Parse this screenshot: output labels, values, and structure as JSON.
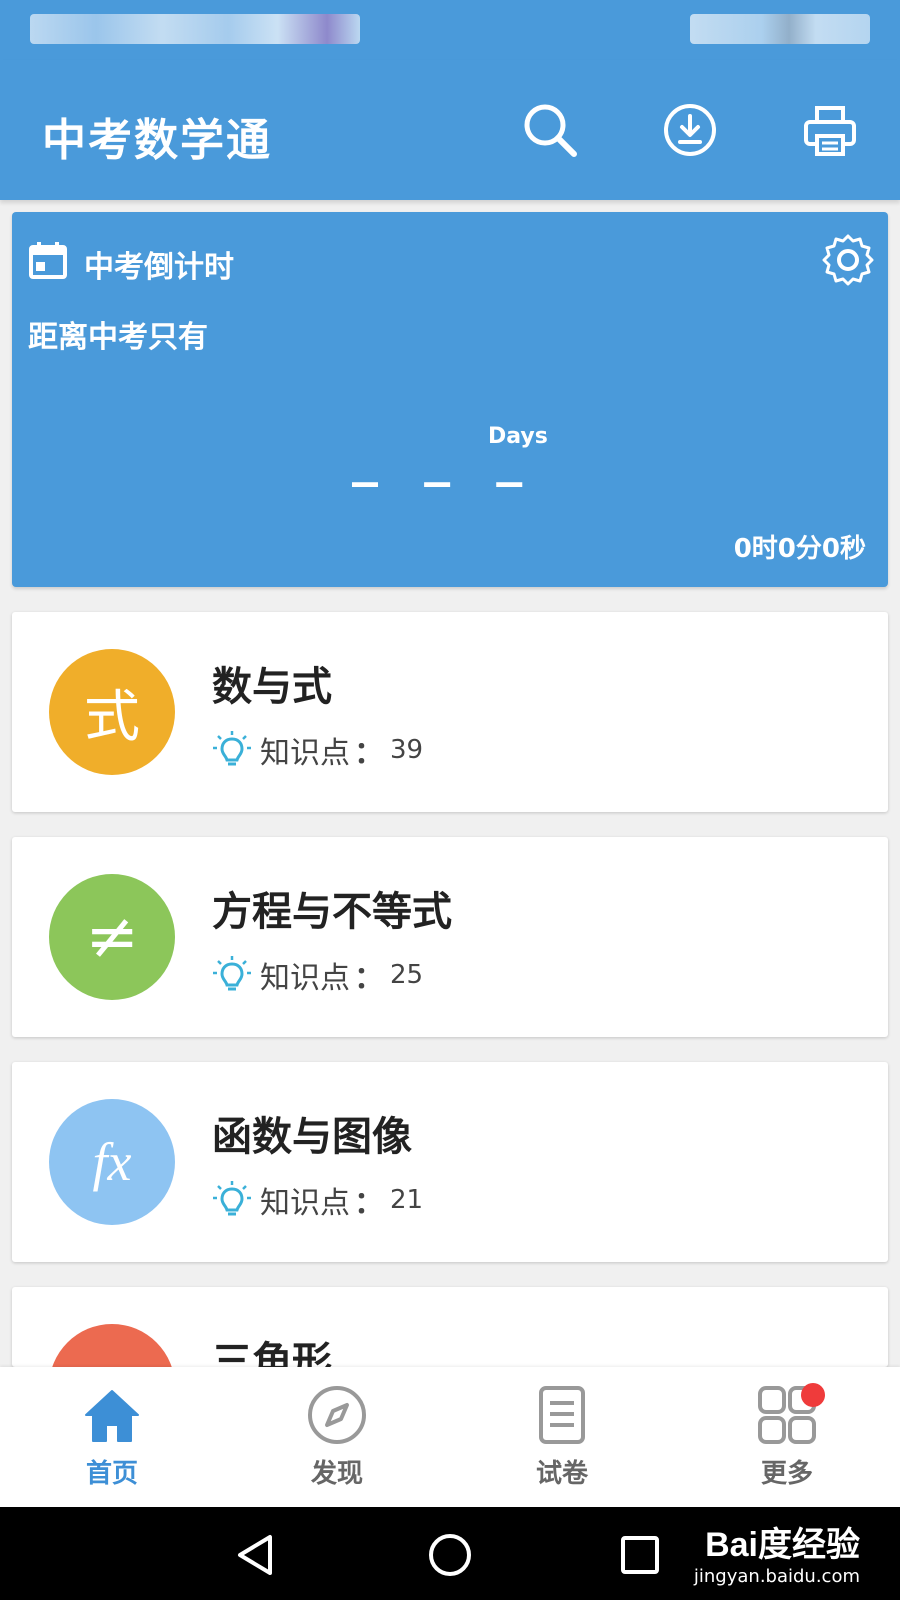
{
  "app": {
    "title": "中考数学通"
  },
  "header_actions": [
    {
      "id": "search",
      "icon": "search-icon"
    },
    {
      "id": "download",
      "icon": "download-icon"
    },
    {
      "id": "print",
      "icon": "printer-icon"
    }
  ],
  "countdown": {
    "title": "中考倒计时",
    "subtitle": "距离中考只有",
    "days": "_ _ _",
    "days_unit": "Days",
    "time": "0时0分0秒",
    "icons": [
      "calendar-icon",
      "gear-icon"
    ]
  },
  "topics": [
    {
      "title": "数与式",
      "icon_text": "式",
      "color": "#f0ae2a",
      "meta_label": "知识点",
      "sep": "：",
      "count": "39"
    },
    {
      "title": "方程与不等式",
      "icon_text": "≠",
      "color": "#8cc65a",
      "meta_label": "知识点",
      "sep": "：",
      "count": "25"
    },
    {
      "title": "函数与图像",
      "icon_text": "fx",
      "color": "#8ec4f2",
      "meta_label": "知识点",
      "sep": "：",
      "count": "21"
    },
    {
      "title": "三角形",
      "icon_text": "",
      "color": "#ec6a50"
    }
  ],
  "nav": [
    {
      "label": "首页",
      "icon": "home-icon",
      "active": true
    },
    {
      "label": "发现",
      "icon": "compass-icon"
    },
    {
      "label": "试卷",
      "icon": "document-icon"
    },
    {
      "label": "更多",
      "icon": "grid-icon",
      "badge": true
    }
  ],
  "watermark": {
    "main": "Bai度经验",
    "sub": "jingyan.baidu.com"
  },
  "colors": {
    "primary": "#4a9ada",
    "accent_blue": "#3d8fd6",
    "badge": "#ef3b3b"
  }
}
